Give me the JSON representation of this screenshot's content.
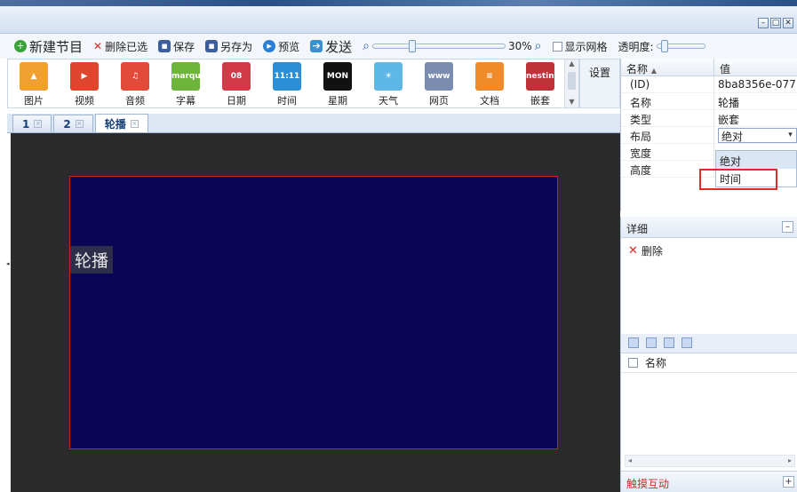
{
  "window": {
    "minimize": "–",
    "maximize": "□",
    "close": "✕"
  },
  "toolbar": {
    "new_program": "新建节目",
    "delete_selected": "删除已选",
    "save": "保存",
    "save_as": "另存为",
    "preview": "预览",
    "send": "发送",
    "zoom_value": "30%",
    "zoom_fraction": 0.3,
    "show_grid": "显示网格",
    "opacity_label": "透明度:",
    "opacity_fraction": 0.15
  },
  "palette": {
    "items": [
      {
        "label": "图片",
        "icon": "picture-icon",
        "glyph": "▲",
        "color": "#f0a030"
      },
      {
        "label": "视频",
        "icon": "video-icon",
        "glyph": "▶",
        "color": "#e0452e"
      },
      {
        "label": "音频",
        "icon": "audio-icon",
        "glyph": "♫",
        "color": "#e24a3a"
      },
      {
        "label": "字幕",
        "icon": "marquee-icon",
        "glyph": "marquee",
        "color": "#6cb43c"
      },
      {
        "label": "日期",
        "icon": "date-icon",
        "glyph": "08",
        "color": "#d23a4a"
      },
      {
        "label": "时间",
        "icon": "time-icon",
        "glyph": "11:11",
        "color": "#2a8fd6"
      },
      {
        "label": "星期",
        "icon": "week-icon",
        "glyph": "MON",
        "color": "#111111"
      },
      {
        "label": "天气",
        "icon": "weather-icon",
        "glyph": "☀",
        "color": "#5fb7e8"
      },
      {
        "label": "网页",
        "icon": "webpage-icon",
        "glyph": "www",
        "color": "#7a8db0"
      },
      {
        "label": "文档",
        "icon": "document-icon",
        "glyph": "≡",
        "color": "#f08a2a"
      },
      {
        "label": "嵌套",
        "icon": "nesting-icon",
        "glyph": "nesting",
        "color": "#c0323a"
      }
    ],
    "settings_label": "设置"
  },
  "tabs": [
    {
      "label": "1"
    },
    {
      "label": "2"
    },
    {
      "label": "轮播"
    }
  ],
  "canvas": {
    "element_label": "轮播"
  },
  "properties": {
    "col_name": "名称",
    "col_value": "值",
    "rows": [
      {
        "key": "(ID)",
        "value": "8ba8356e-077..."
      },
      {
        "key": "名称",
        "value": "轮播"
      },
      {
        "key": "类型",
        "value": "嵌套"
      },
      {
        "key": "布局",
        "value": "绝对"
      },
      {
        "key": "宽度",
        "value": ""
      },
      {
        "key": "高度",
        "value": ""
      }
    ],
    "layout_options": [
      "绝对",
      "时间"
    ]
  },
  "detail": {
    "title": "详细",
    "delete_label": "删除",
    "collapse": "–"
  },
  "layers": {
    "name_header": "名称"
  },
  "touch": {
    "label": "触摸互动",
    "expand": "+"
  }
}
